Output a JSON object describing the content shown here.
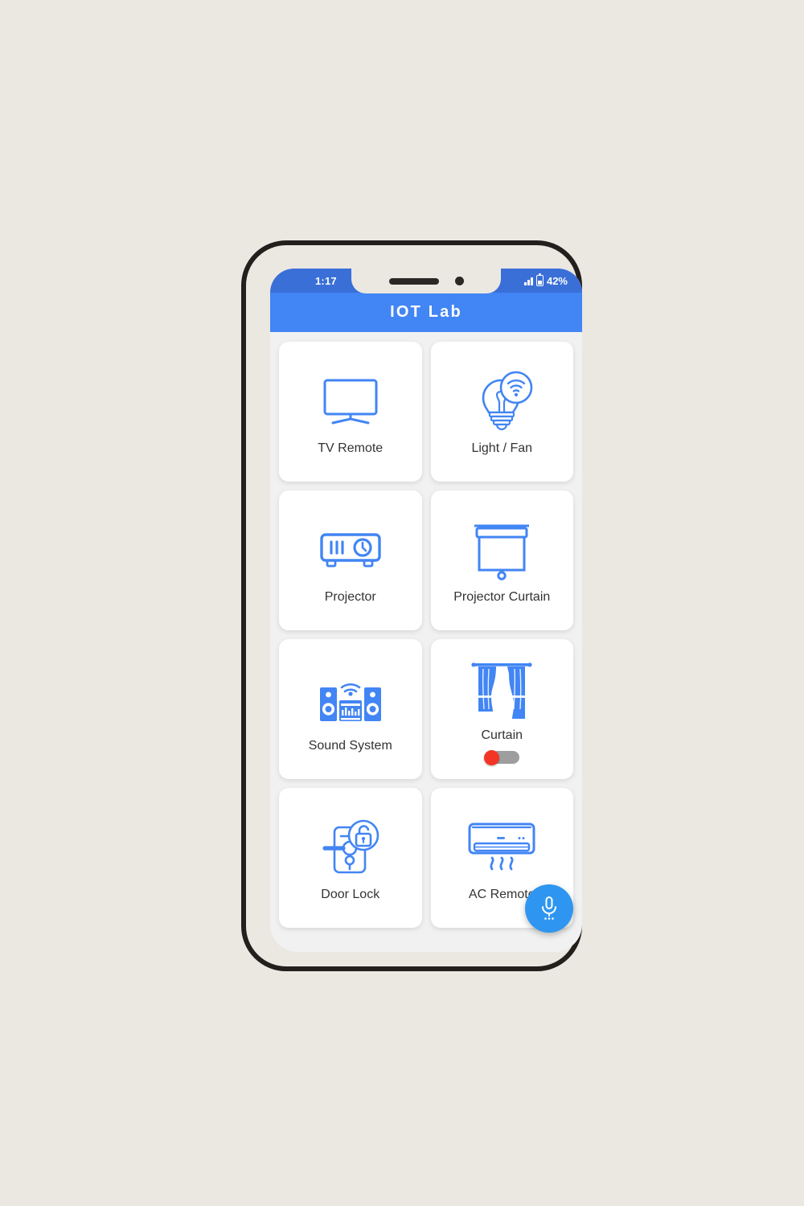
{
  "theme": {
    "backdrop": "#ebe8e1",
    "status_bar_bg": "#3a6fd8",
    "app_bar_bg": "#4285f4",
    "screen_bg": "#f1f1f1",
    "card_bg": "#ffffff",
    "icon_blue": "#4285f4",
    "label_color": "#333333",
    "fab_blue": "#2e96f0",
    "toggle_off_thumb": "#f33527",
    "toggle_track": "#9e9e9e"
  },
  "status_bar": {
    "time": "1:17",
    "battery_percent": "42%",
    "signal_icon": "signal-bars-icon",
    "battery_icon": "battery-icon"
  },
  "app_bar": {
    "title": "IOT Lab"
  },
  "devices": [
    {
      "label": "TV Remote",
      "icon": "tv-icon",
      "has_toggle": false
    },
    {
      "label": "Light / Fan",
      "icon": "smart-bulb-wifi-icon",
      "has_toggle": false
    },
    {
      "label": "Projector",
      "icon": "projector-icon",
      "has_toggle": false
    },
    {
      "label": "Projector Curtain",
      "icon": "projection-screen-icon",
      "has_toggle": false
    },
    {
      "label": "Sound System",
      "icon": "speakers-icon",
      "has_toggle": false
    },
    {
      "label": "Curtain",
      "icon": "curtains-icon",
      "has_toggle": true,
      "toggle_state": "off"
    },
    {
      "label": "Door Lock",
      "icon": "door-lock-icon",
      "has_toggle": false
    },
    {
      "label": "AC Remote",
      "icon": "air-conditioner-icon",
      "has_toggle": false
    }
  ],
  "fab": {
    "icon": "microphone-icon"
  }
}
